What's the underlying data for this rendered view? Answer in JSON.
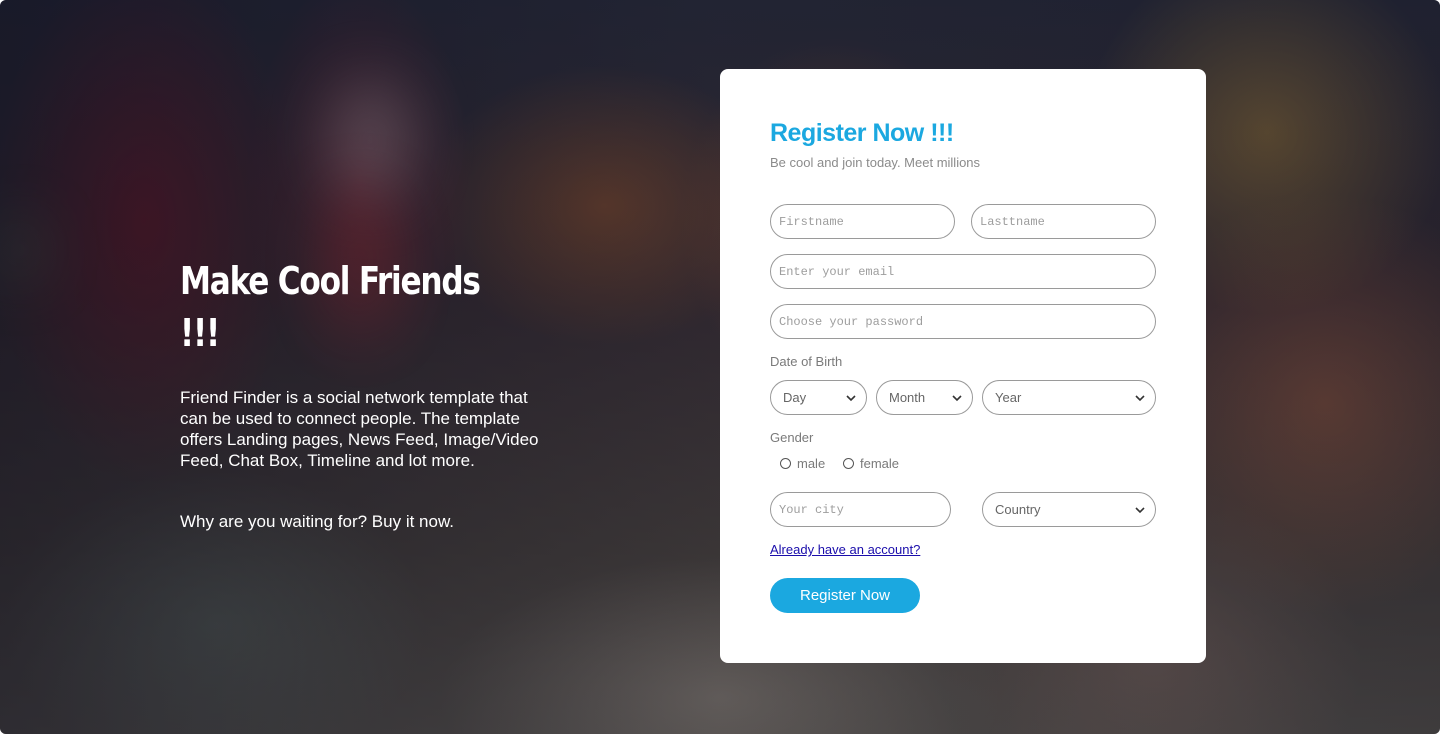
{
  "hero": {
    "title": "Make Cool Friends !!!",
    "description": "Friend Finder is a social network template that can be used to connect people. The template offers Landing pages, News Feed, Image/Video Feed, Chat Box, Timeline and lot more.",
    "cta": "Why are you waiting for? Buy it now."
  },
  "register": {
    "title": "Register Now !!!",
    "subtitle": "Be cool and join today. Meet millions",
    "firstname_placeholder": "Firstname",
    "lastname_placeholder": "Lasttname",
    "email_placeholder": "Enter your email",
    "password_placeholder": "Choose your password",
    "dob_label": "Date of Birth",
    "day_select": "Day",
    "month_select": "Month",
    "year_select": "Year",
    "gender_label": "Gender",
    "gender_male": "male",
    "gender_female": "female",
    "city_placeholder": "Your city",
    "country_select": "Country",
    "login_link": "Already have an account?",
    "submit_label": "Register Now"
  },
  "colors": {
    "accent": "#1ba8e0",
    "link": "#1a0dab"
  }
}
